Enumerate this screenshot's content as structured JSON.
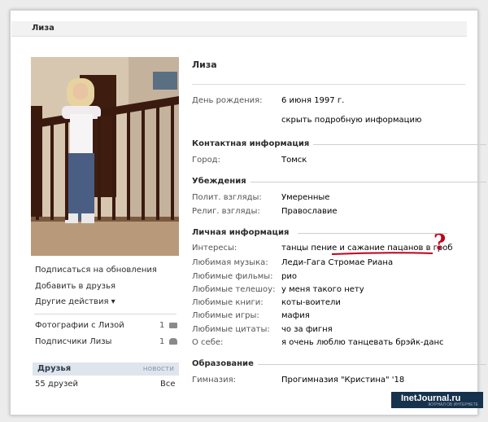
{
  "header": {
    "title": "Лиза"
  },
  "profile": {
    "name": "Лиза",
    "birthday_label": "День рождения:",
    "birthday_value": "6 июня 1997 г.",
    "hide_info": "скрыть подробную информацию"
  },
  "contact": {
    "section": "Контактная информация",
    "city_label": "Город:",
    "city_value": "Томск"
  },
  "beliefs": {
    "section": "Убеждения",
    "political_label": "Полит. взгляды:",
    "political_value": "Умеренные",
    "religious_label": "Религ. взгляды:",
    "religious_value": "Православие"
  },
  "personal": {
    "section": "Личная информация",
    "interests_label": "Интересы:",
    "interests_value": "танцы пение и сажание пацанов в гроб",
    "music_label": "Любимая музыка:",
    "music_value": "Леди-Гага Стромае Риана",
    "movies_label": "Любимые фильмы:",
    "movies_value": "рио",
    "tv_label": "Любимые телешоу:",
    "tv_value": "у меня такого нету",
    "books_label": "Любимые книги:",
    "books_value": "коты-воители",
    "games_label": "Любимые игры:",
    "games_value": "мафия",
    "quotes_label": "Любимые цитаты:",
    "quotes_value": "чо за фигня",
    "about_label": "О себе:",
    "about_value": "я очень люблю танцевать брэйк-данс"
  },
  "education": {
    "section": "Образование",
    "school_label": "Гимназия:",
    "school_value": "Прогимназия \"Кристина\" '18"
  },
  "actions": {
    "subscribe": "Подписаться на обновления",
    "add_friend": "Добавить в друзья",
    "other": "Другие действия ▾"
  },
  "left_links": {
    "photos": "Фотографии с Лизой",
    "photos_count": "1",
    "followers": "Подписчики Лизы",
    "followers_count": "1"
  },
  "friends": {
    "header": "Друзья",
    "news": "новости",
    "count": "55 друзей",
    "all": "Все"
  },
  "annotation": {
    "mark": "?",
    "color": "#c0001a"
  },
  "watermark": {
    "text": "InetJournal.ru",
    "sub": "ЖУРНАЛ ОБ ИНТЕРНЕТЕ"
  },
  "colors": {
    "link": "#2b587a",
    "accent_red": "#c0001a",
    "friends_header": "#dfe5ec"
  }
}
